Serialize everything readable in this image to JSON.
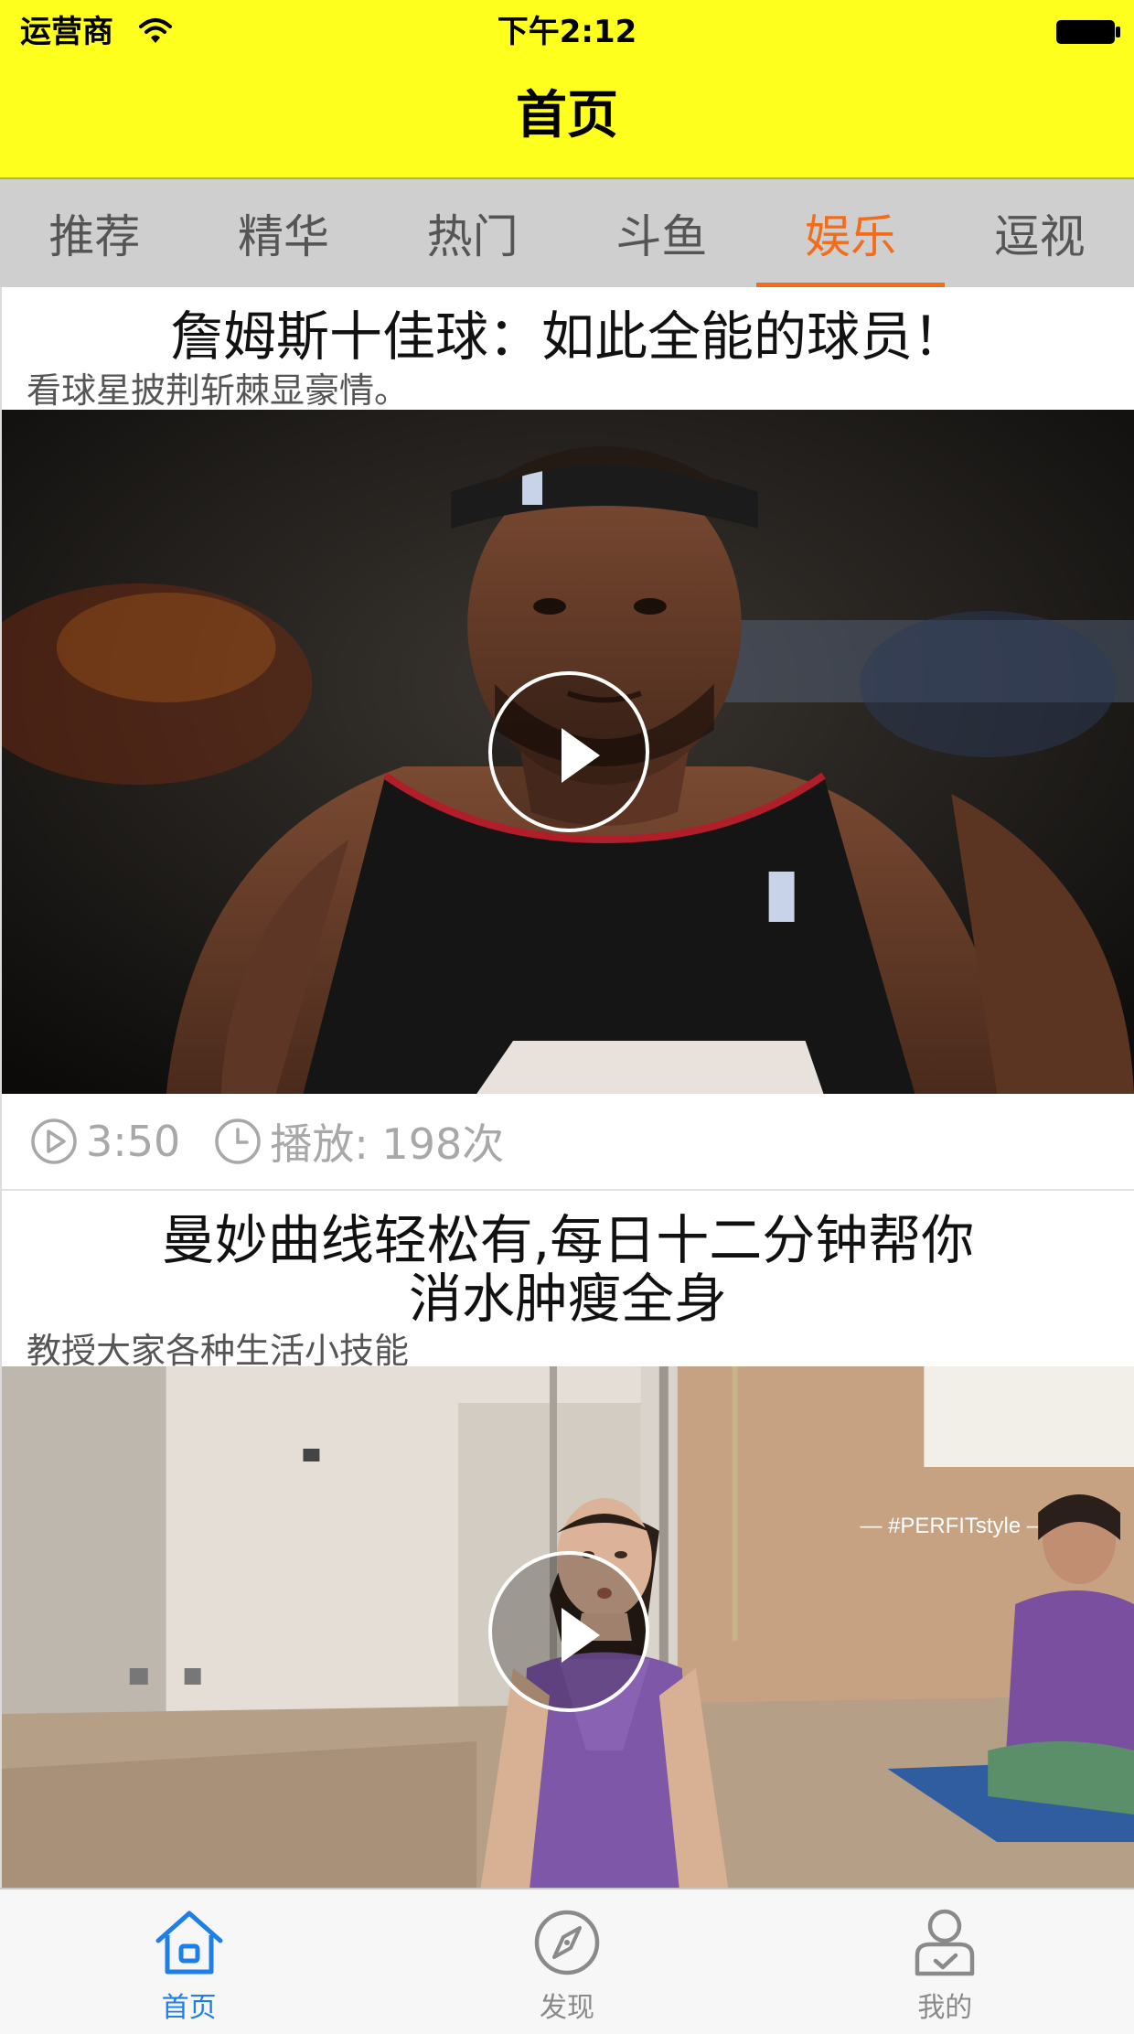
{
  "status_bar": {
    "carrier": "运营商",
    "time": "下午2:12"
  },
  "nav": {
    "title": "首页"
  },
  "tabs": [
    {
      "label": "推荐",
      "active": false
    },
    {
      "label": "精华",
      "active": false
    },
    {
      "label": "热门",
      "active": false
    },
    {
      "label": "斗鱼",
      "active": false
    },
    {
      "label": "娱乐",
      "active": true
    },
    {
      "label": "逗视",
      "active": false
    }
  ],
  "feed": [
    {
      "title": "詹姆斯十佳球：如此全能的球员！",
      "subtitle": "看球星披荆斩棘显豪情。",
      "duration": "3:50",
      "plays": "播放: 198次"
    },
    {
      "title": "曼妙曲线轻松有,每日十二分钟帮你消水肿瘦全身",
      "subtitle": "教授大家各种生活小技能",
      "watermark": "— #PERFITstyle —"
    }
  ],
  "tabbar": [
    {
      "label": "首页",
      "icon": "home-icon",
      "active": true
    },
    {
      "label": "发现",
      "icon": "compass-icon",
      "active": false
    },
    {
      "label": "我的",
      "icon": "profile-icon",
      "active": false
    }
  ],
  "colors": {
    "header_bg": "#ffff1e",
    "tab_active": "#f36c1b",
    "tabbar_active": "#1e7fe8"
  }
}
